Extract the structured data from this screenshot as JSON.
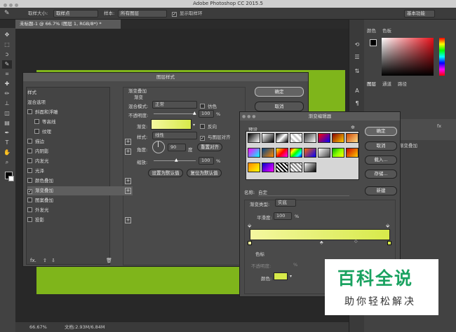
{
  "app": {
    "title": "Adobe Photoshop CC 2015.5"
  },
  "options_bar": {
    "sample_size_label": "取样大小:",
    "sample_size_value": "取样点",
    "sample_label": "样本:",
    "sample_value": "所有图层",
    "show_ring_label": "显示取样环",
    "workspace": "基本功能"
  },
  "document": {
    "tab": "未标题-1 @ 66.7% (图层 1, RGB/8*) *",
    "zoom": "66.67%",
    "doc_size": "文档:2.93M/6.84M"
  },
  "right_panels": {
    "color_tabs": [
      "颜色",
      "色板"
    ],
    "layer_tabs": [
      "图层",
      "通道",
      "路径"
    ],
    "effect_label": "渐变叠加",
    "fx": "fx"
  },
  "layer_style": {
    "title": "图层样式",
    "styles_header": "样式",
    "blend_options": "混合选项",
    "items": [
      {
        "label": "斜面和浮雕",
        "checked": false,
        "plus": false
      },
      {
        "label": "等高线",
        "checked": false,
        "plus": false,
        "indent": true
      },
      {
        "label": "纹理",
        "checked": false,
        "plus": false,
        "indent": true
      },
      {
        "label": "描边",
        "checked": false,
        "plus": true
      },
      {
        "label": "内阴影",
        "checked": false,
        "plus": true
      },
      {
        "label": "内发光",
        "checked": false,
        "plus": false
      },
      {
        "label": "光泽",
        "checked": false,
        "plus": false
      },
      {
        "label": "颜色叠加",
        "checked": false,
        "plus": true
      },
      {
        "label": "渐变叠加",
        "checked": true,
        "plus": true
      },
      {
        "label": "图案叠加",
        "checked": false,
        "plus": false
      },
      {
        "label": "外发光",
        "checked": false,
        "plus": false
      },
      {
        "label": "投影",
        "checked": false,
        "plus": true
      }
    ],
    "section_title": "渐变叠加",
    "subsection": "渐变",
    "blend_mode_label": "混合模式:",
    "blend_mode_value": "正常",
    "dither_label": "仿色",
    "opacity_label": "不透明度:",
    "opacity_value": "100",
    "percent": "%",
    "gradient_label": "渐变:",
    "reverse_label": "反向",
    "style_label": "样式:",
    "style_value": "线性",
    "align_label": "与图层对齐",
    "angle_label": "角度:",
    "angle_value": "90",
    "degree": "度",
    "reset_align": "重置对齐",
    "scale_label": "缩放:",
    "scale_value": "100",
    "set_default": "设置为默认值",
    "reset_default": "复位为默认值",
    "ok": "确定",
    "cancel": "取消",
    "fx": "fx."
  },
  "gradient_editor": {
    "title": "渐变编辑器",
    "presets_label": "预设",
    "ok": "确定",
    "cancel": "取消",
    "load": "载入...",
    "save": "存储...",
    "name_label": "名称:",
    "name_value": "自定",
    "new": "新建",
    "type_label": "渐变类型:",
    "type_value": "实底",
    "smoothness_label": "平滑度:",
    "smoothness_value": "100",
    "percent": "%",
    "stops_label": "色标",
    "stop_opacity_label": "不透明度:",
    "color_label": "颜色:",
    "gradient_colors": [
      "#f4f7a0",
      "#d7ea4a"
    ],
    "stop_color": "#d7ea4a"
  },
  "watermark": {
    "line1": "百科全说",
    "line2": "助你轻松解决"
  }
}
